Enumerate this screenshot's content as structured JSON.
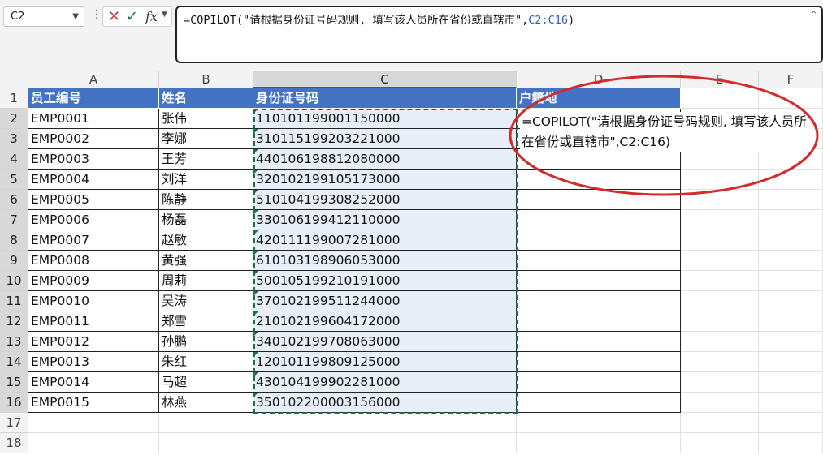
{
  "name_box": {
    "value": "C2"
  },
  "formula_bar": {
    "prefix": "=COPILOT(\"请根据身份证号码规则, 填写该人员所在省份或直辖市\",",
    "ref": "C2:C16",
    "suffix": ")",
    "fx_label": "fx"
  },
  "columns": [
    "A",
    "B",
    "C",
    "D",
    "E",
    "F"
  ],
  "rows": [
    "1",
    "2",
    "3",
    "4",
    "5",
    "6",
    "7",
    "8",
    "9",
    "10",
    "11",
    "12",
    "13",
    "14",
    "15",
    "16",
    "17",
    "18"
  ],
  "header": {
    "a": "员工编号",
    "b": "姓名",
    "c": "身份证号码",
    "d": "户籍地"
  },
  "records": [
    {
      "id": "EMP0001",
      "name": "张伟",
      "idno": "110101199001150000"
    },
    {
      "id": "EMP0002",
      "name": "李娜",
      "idno": "310115199203221000"
    },
    {
      "id": "EMP0003",
      "name": "王芳",
      "idno": "440106198812080000"
    },
    {
      "id": "EMP0004",
      "name": "刘洋",
      "idno": "320102199105173000"
    },
    {
      "id": "EMP0005",
      "name": "陈静",
      "idno": "510104199308252000"
    },
    {
      "id": "EMP0006",
      "name": "杨磊",
      "idno": "330106199412110000"
    },
    {
      "id": "EMP0007",
      "name": "赵敏",
      "idno": "420111199007281000"
    },
    {
      "id": "EMP0008",
      "name": "黄强",
      "idno": "610103198906053000"
    },
    {
      "id": "EMP0009",
      "name": "周莉",
      "idno": "500105199210191000"
    },
    {
      "id": "EMP0010",
      "name": "吴涛",
      "idno": "370102199511244000"
    },
    {
      "id": "EMP0011",
      "name": "郑雪",
      "idno": "210102199604172000"
    },
    {
      "id": "EMP0012",
      "name": "孙鹏",
      "idno": "340102199708063000"
    },
    {
      "id": "EMP0013",
      "name": "朱红",
      "idno": "120101199809125000"
    },
    {
      "id": "EMP0014",
      "name": "马超",
      "idno": "430104199902281000"
    },
    {
      "id": "EMP0015",
      "name": "林燕",
      "idno": "350102200003156000"
    }
  ],
  "d2_formula_display": "=COPILOT(\"请根据身份证号码规则, 填写该人员所在省份或直辖市\",C2:C16)",
  "colors": {
    "header_fill": "#4472c4",
    "selection": "#107c41",
    "annotation": "#d42a2a"
  }
}
